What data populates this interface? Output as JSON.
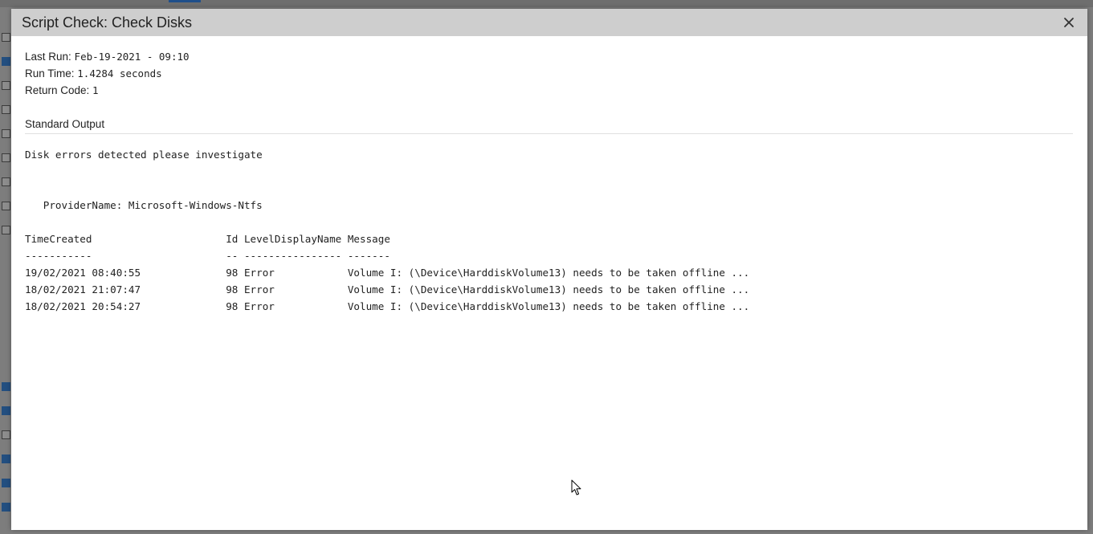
{
  "dialog": {
    "title": "Script Check: Check Disks",
    "close_glyph": "✕"
  },
  "meta": {
    "last_run_label": "Last Run: ",
    "last_run_value": "Feb-19-2021 - 09:10",
    "run_time_label": "Run Time: ",
    "run_time_value": "1.4284 seconds",
    "return_code_label": "Return Code: ",
    "return_code_value": "1"
  },
  "standard_output": {
    "title": "Standard Output",
    "lines": [
      "Disk errors detected please investigate",
      "",
      "",
      "   ProviderName: Microsoft-Windows-Ntfs",
      "",
      "TimeCreated                      Id LevelDisplayName Message",
      "-----------                      -- ---------------- -------",
      "19/02/2021 08:40:55              98 Error            Volume I: (\\Device\\HarddiskVolume13) needs to be taken offline ...",
      "18/02/2021 21:07:47              98 Error            Volume I: (\\Device\\HarddiskVolume13) needs to be taken offline ...",
      "18/02/2021 20:54:27              98 Error            Volume I: (\\Device\\HarddiskVolume13) needs to be taken offline ..."
    ]
  },
  "icons": {
    "close": "close-icon",
    "cursor": "mouse-pointer-icon"
  },
  "colors": {
    "header_bg": "#cecece",
    "overlay_bg": "#7f7f7f",
    "text": "#222222",
    "background_accent": "#234f80"
  }
}
